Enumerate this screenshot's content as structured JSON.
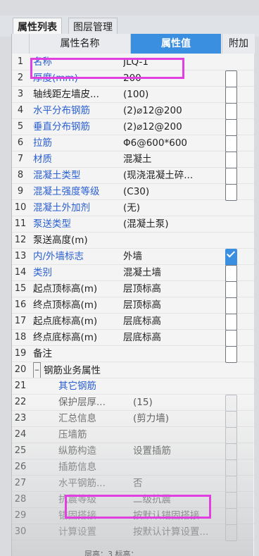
{
  "tabs": [
    {
      "label": "属性列表",
      "active": true
    },
    {
      "label": "图层管理",
      "active": false
    }
  ],
  "columns": {
    "num": "",
    "name": "属性名称",
    "value": "属性值",
    "add": "附加"
  },
  "rows": [
    {
      "num": "1",
      "name": "名称",
      "value": "JLQ-1",
      "name_style": "blue",
      "checkbox": false,
      "show_checkbox": false
    },
    {
      "num": "2",
      "name": "厚度(mm)",
      "value": "200",
      "name_style": "blue",
      "checkbox": false,
      "show_checkbox": true
    },
    {
      "num": "3",
      "name": "轴线距左墙皮...",
      "value": "(100)",
      "name_style": "dark",
      "checkbox": false,
      "show_checkbox": true
    },
    {
      "num": "4",
      "name": "水平分布钢筋",
      "value": "(2)⌀12@200",
      "name_style": "blue",
      "checkbox": false,
      "show_checkbox": true
    },
    {
      "num": "5",
      "name": "垂直分布钢筋",
      "value": "(2)⌀12@200",
      "name_style": "blue",
      "checkbox": false,
      "show_checkbox": true
    },
    {
      "num": "6",
      "name": "拉筋",
      "value": "Φ6@600*600",
      "name_style": "blue",
      "checkbox": false,
      "show_checkbox": true
    },
    {
      "num": "7",
      "name": "材质",
      "value": "混凝土",
      "name_style": "blue",
      "checkbox": false,
      "show_checkbox": true
    },
    {
      "num": "8",
      "name": "混凝土类型",
      "value": "(现浇混凝土碎...",
      "name_style": "blue",
      "checkbox": false,
      "show_checkbox": true
    },
    {
      "num": "9",
      "name": "混凝土强度等级",
      "value": "(C30)",
      "name_style": "blue",
      "checkbox": false,
      "show_checkbox": true
    },
    {
      "num": "10",
      "name": "混凝土外加剂",
      "value": "(无)",
      "name_style": "blue",
      "checkbox": false,
      "show_checkbox": false
    },
    {
      "num": "11",
      "name": "泵送类型",
      "value": "(混凝土泵)",
      "name_style": "blue",
      "checkbox": false,
      "show_checkbox": false
    },
    {
      "num": "12",
      "name": "泵送高度(m)",
      "value": "",
      "name_style": "dark",
      "checkbox": false,
      "show_checkbox": false
    },
    {
      "num": "13",
      "name": "内/外墙标志",
      "value": "外墙",
      "name_style": "blue",
      "checkbox": true,
      "show_checkbox": true
    },
    {
      "num": "14",
      "name": "类别",
      "value": "混凝土墙",
      "name_style": "blue",
      "checkbox": false,
      "show_checkbox": true
    },
    {
      "num": "15",
      "name": "起点顶标高(m)",
      "value": "层顶标高",
      "name_style": "dark",
      "checkbox": false,
      "show_checkbox": true
    },
    {
      "num": "16",
      "name": "终点顶标高(m)",
      "value": "层顶标高",
      "name_style": "dark",
      "checkbox": false,
      "show_checkbox": true
    },
    {
      "num": "17",
      "name": "起点底标高(m)",
      "value": "层底标高",
      "name_style": "dark",
      "checkbox": false,
      "show_checkbox": true
    },
    {
      "num": "18",
      "name": "终点底标高(m)",
      "value": "层底标高",
      "name_style": "dark",
      "checkbox": false,
      "show_checkbox": true
    },
    {
      "num": "19",
      "name": "备注",
      "value": "",
      "name_style": "dark",
      "checkbox": false,
      "show_checkbox": true
    },
    {
      "num": "20",
      "name": "钢筋业务属性",
      "value": "",
      "name_style": "dark",
      "checkbox": false,
      "show_checkbox": false,
      "expander": "−"
    },
    {
      "num": "21",
      "name": "其它钢筋",
      "value": "",
      "name_style": "blue",
      "checkbox": false,
      "show_checkbox": false,
      "indent": true
    },
    {
      "num": "22",
      "name": "保护层厚...",
      "value": "(15)",
      "name_style": "gray",
      "checkbox": false,
      "show_checkbox": true,
      "indent": true
    },
    {
      "num": "23",
      "name": "汇总信息",
      "value": "(剪力墙)",
      "name_style": "gray",
      "checkbox": false,
      "show_checkbox": true,
      "indent": true
    },
    {
      "num": "24",
      "name": "压墙筋",
      "value": "",
      "name_style": "gray",
      "checkbox": false,
      "show_checkbox": true,
      "indent": true
    },
    {
      "num": "25",
      "name": "纵筋构造",
      "value": "设置插筋",
      "name_style": "gray",
      "checkbox": false,
      "show_checkbox": true,
      "indent": true
    },
    {
      "num": "26",
      "name": "插筋信息",
      "value": "",
      "name_style": "gray",
      "checkbox": false,
      "show_checkbox": true,
      "indent": true
    },
    {
      "num": "27",
      "name": "水平钢筋...",
      "value": "否",
      "name_style": "gray",
      "checkbox": false,
      "show_checkbox": true,
      "indent": true
    },
    {
      "num": "28",
      "name": "抗震等级",
      "value": "二级抗震",
      "name_style": "gray",
      "checkbox": false,
      "show_checkbox": true,
      "indent": true
    },
    {
      "num": "29",
      "name": "锚固搭接",
      "value": "按默认锚固搭接...",
      "name_style": "gray",
      "checkbox": false,
      "show_checkbox": true,
      "indent": true
    },
    {
      "num": "30",
      "name": "计算设置",
      "value": "按默认计算设置...",
      "name_style": "gray",
      "checkbox": false,
      "show_checkbox": true,
      "indent": true
    }
  ],
  "status_text": "层高：3    标高：",
  "colors": {
    "accent": "#3b8fe0",
    "link": "#2a5fd0",
    "highlight": "#e040e0"
  }
}
